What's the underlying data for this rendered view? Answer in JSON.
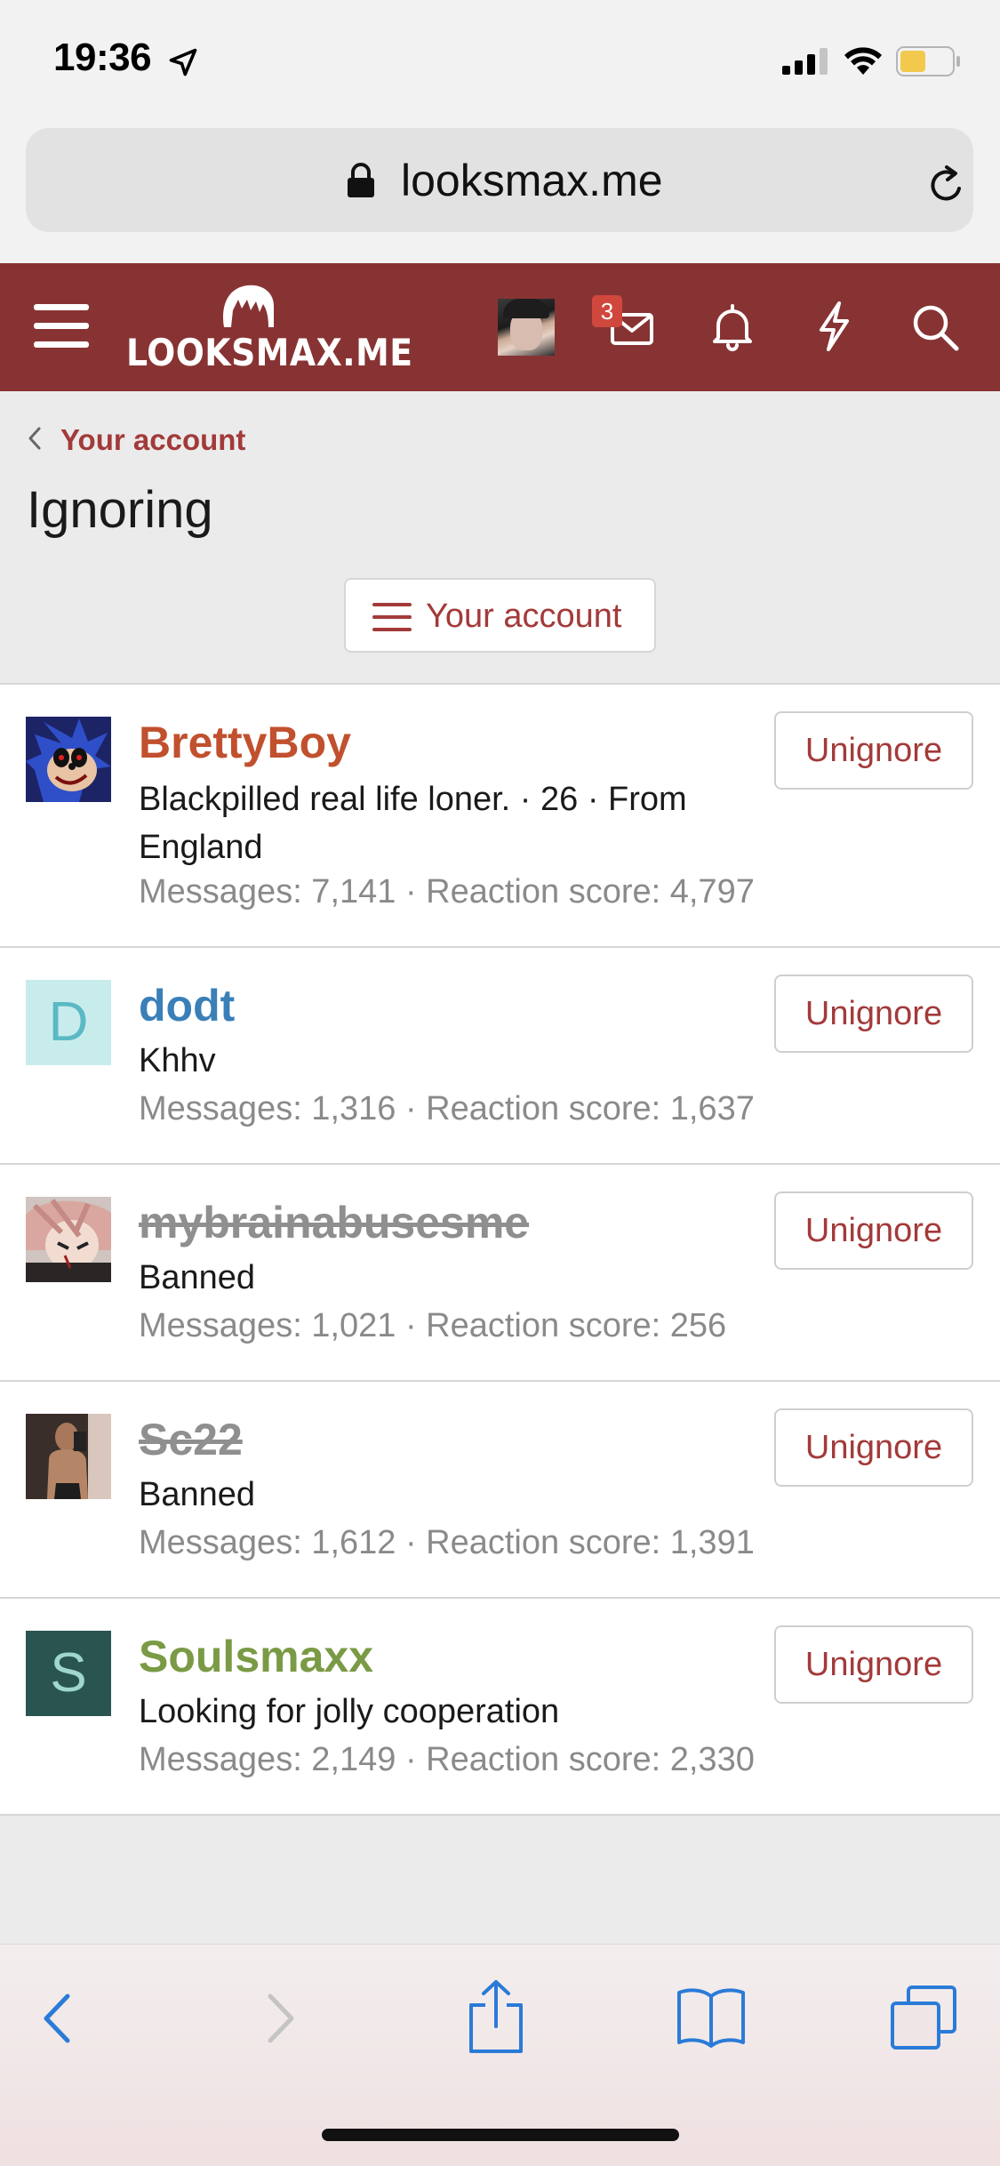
{
  "status_bar": {
    "time": "19:36"
  },
  "browser": {
    "url": "looksmax.me"
  },
  "header": {
    "logo_text": "LOOKSMAX.ME",
    "inbox_badge": "3"
  },
  "page": {
    "breadcrumb": "Your account",
    "title": "Ignoring",
    "account_menu_label": "Your account"
  },
  "ignored_users": [
    {
      "name": "BrettyBoy",
      "name_color": "#c1502e",
      "banned": false,
      "title": "Blackpilled real life loner. · 26 · From England",
      "stats": "Messages: 7,141 · Reaction score: 4,797",
      "button": "Unignore"
    },
    {
      "name": "dodt",
      "name_color": "#3a7fb8",
      "banned": false,
      "avatar_letter": "D",
      "avatar_bg": "#c8ecec",
      "avatar_fg": "#5ab9c4",
      "title": "Khhv",
      "stats": "Messages: 1,316 · Reaction score: 1,637",
      "button": "Unignore"
    },
    {
      "name": "mybrainabusesme",
      "name_color": "#8f8f8f",
      "banned": true,
      "title": "Banned",
      "stats": "Messages: 1,021 · Reaction score: 256",
      "button": "Unignore"
    },
    {
      "name": "Sc22",
      "name_color": "#8f8f8f",
      "banned": true,
      "title": "Banned",
      "stats": "Messages: 1,612 · Reaction score: 1,391",
      "button": "Unignore"
    },
    {
      "name": "Soulsmaxx",
      "name_color": "#7a9a45",
      "banned": false,
      "avatar_letter": "S",
      "avatar_bg": "#2a5450",
      "avatar_fg": "#9fd6cf",
      "title": "Looking for jolly cooperation",
      "stats": "Messages: 2,149 · Reaction score: 2,330",
      "button": "Unignore"
    }
  ],
  "colors": {
    "brand_header": "#883333",
    "link": "#a33a3a",
    "ios_blue": "#2a7bd8"
  },
  "toolbar_icons": [
    "back-icon",
    "forward-icon",
    "share-icon",
    "bookmarks-icon",
    "tabs-icon"
  ]
}
